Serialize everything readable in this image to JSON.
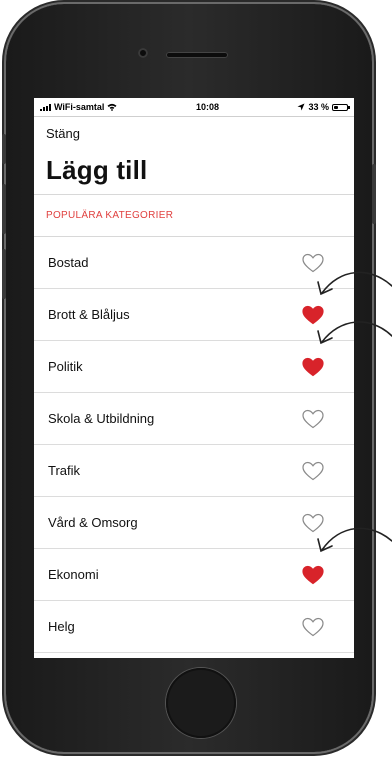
{
  "status_bar": {
    "carrier": "WiFi-samtal",
    "time": "10:08",
    "battery": "33 %",
    "battery_level": 0.33
  },
  "header": {
    "close_label": "Stäng",
    "title": "Lägg till"
  },
  "section": {
    "title": "POPULÄRA KATEGORIER"
  },
  "categories": [
    {
      "label": "Bostad",
      "favorite": false
    },
    {
      "label": "Brott & Blåljus",
      "favorite": true
    },
    {
      "label": "Politik",
      "favorite": true
    },
    {
      "label": "Skola & Utbildning",
      "favorite": false
    },
    {
      "label": "Trafik",
      "favorite": false
    },
    {
      "label": "Vård & Omsorg",
      "favorite": false
    },
    {
      "label": "Ekonomi",
      "favorite": true
    },
    {
      "label": "Helg",
      "favorite": false
    }
  ],
  "colors": {
    "accent": "#e0403f",
    "heart_filled": "#d8232a",
    "heart_outline": "#8a8a8a"
  },
  "icons": {
    "favorite_on": "heart-filled-icon",
    "favorite_off": "heart-outline-icon"
  }
}
